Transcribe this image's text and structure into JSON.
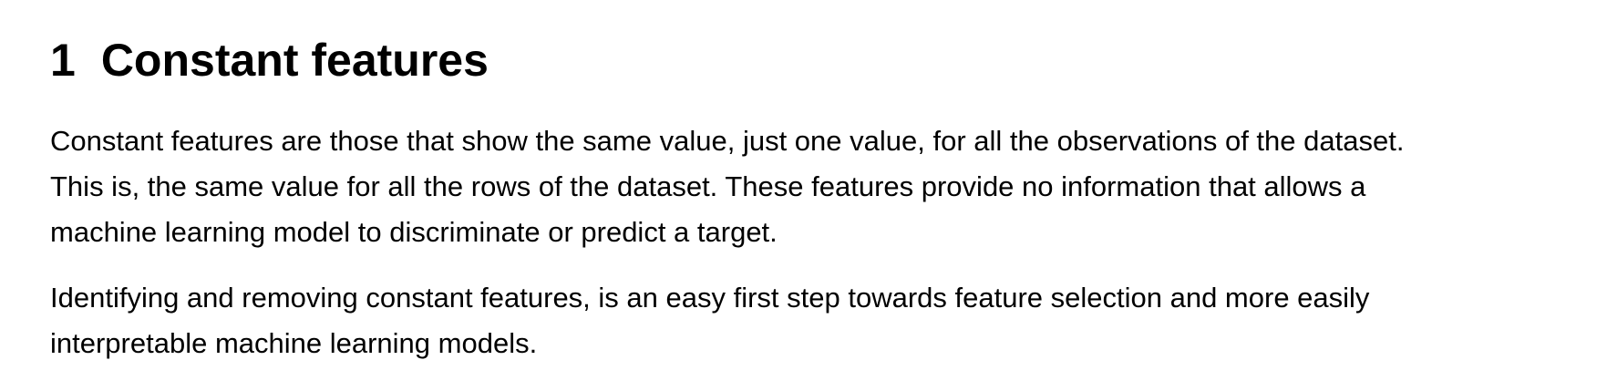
{
  "section": {
    "number": "1",
    "title": "Constant features"
  },
  "paragraphs": [
    {
      "lines": [
        "Constant features are those that show the same value, just one value, for all the observations of the dataset.",
        "This is, the same value for all the rows of the dataset. These features provide no information that allows a",
        "machine learning model to discriminate or predict a target."
      ]
    },
    {
      "lines": [
        "Identifying and removing constant features, is an easy first step towards feature selection and more easily",
        "interpretable machine learning models."
      ]
    }
  ]
}
